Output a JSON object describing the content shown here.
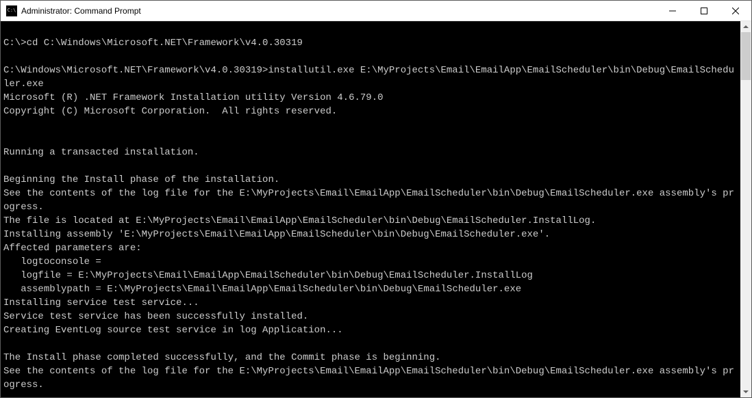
{
  "window": {
    "title": "Administrator: Command Prompt"
  },
  "console": {
    "lines": [
      "",
      "C:\\>cd C:\\Windows\\Microsoft.NET\\Framework\\v4.0.30319",
      "",
      "C:\\Windows\\Microsoft.NET\\Framework\\v4.0.30319>installutil.exe E:\\MyProjects\\Email\\EmailApp\\EmailScheduler\\bin\\Debug\\EmailScheduler.exe",
      "Microsoft (R) .NET Framework Installation utility Version 4.6.79.0",
      "Copyright (C) Microsoft Corporation.  All rights reserved.",
      "",
      "",
      "Running a transacted installation.",
      "",
      "Beginning the Install phase of the installation.",
      "See the contents of the log file for the E:\\MyProjects\\Email\\EmailApp\\EmailScheduler\\bin\\Debug\\EmailScheduler.exe assembly's progress.",
      "The file is located at E:\\MyProjects\\Email\\EmailApp\\EmailScheduler\\bin\\Debug\\EmailScheduler.InstallLog.",
      "Installing assembly 'E:\\MyProjects\\Email\\EmailApp\\EmailScheduler\\bin\\Debug\\EmailScheduler.exe'.",
      "Affected parameters are:",
      "   logtoconsole =",
      "   logfile = E:\\MyProjects\\Email\\EmailApp\\EmailScheduler\\bin\\Debug\\EmailScheduler.InstallLog",
      "   assemblypath = E:\\MyProjects\\Email\\EmailApp\\EmailScheduler\\bin\\Debug\\EmailScheduler.exe",
      "Installing service test service...",
      "Service test service has been successfully installed.",
      "Creating EventLog source test service in log Application...",
      "",
      "The Install phase completed successfully, and the Commit phase is beginning.",
      "See the contents of the log file for the E:\\MyProjects\\Email\\EmailApp\\EmailScheduler\\bin\\Debug\\EmailScheduler.exe assembly's progress."
    ]
  }
}
